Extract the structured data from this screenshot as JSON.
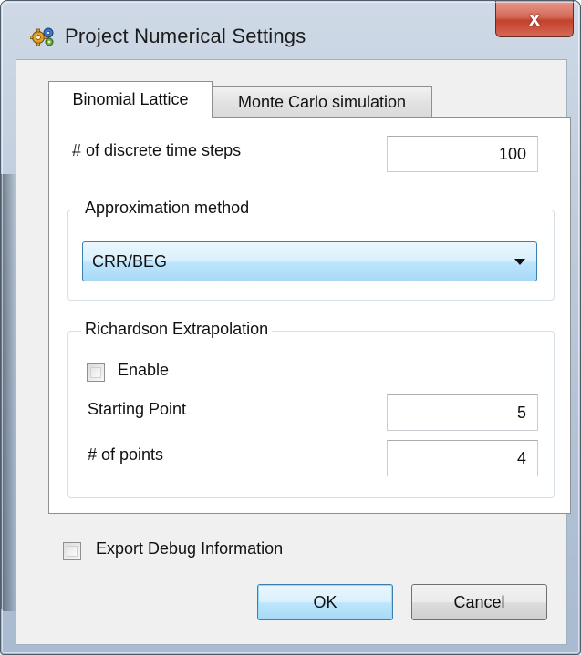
{
  "window": {
    "title": "Project Numerical Settings",
    "close_label": "x",
    "icon": "gears-icon"
  },
  "tabs": [
    {
      "label": "Binomial Lattice",
      "selected": true
    },
    {
      "label": "Monte Carlo simulation",
      "selected": false
    }
  ],
  "binomial": {
    "time_steps_label": "# of discrete time steps",
    "time_steps_value": "100",
    "approximation": {
      "group_title": "Approximation method",
      "selected": "CRR/BEG"
    },
    "richardson": {
      "group_title": "Richardson Extrapolation",
      "enable_label": "Enable",
      "enable_checked": false,
      "starting_point_label": "Starting Point",
      "starting_point_value": "5",
      "num_points_label": "# of points",
      "num_points_value": "4"
    }
  },
  "export_debug": {
    "label": "Export Debug Information",
    "checked": false
  },
  "buttons": {
    "ok": "OK",
    "cancel": "Cancel"
  },
  "colors": {
    "close_button": "#c2412d",
    "focus_border": "#3c7fb1"
  }
}
